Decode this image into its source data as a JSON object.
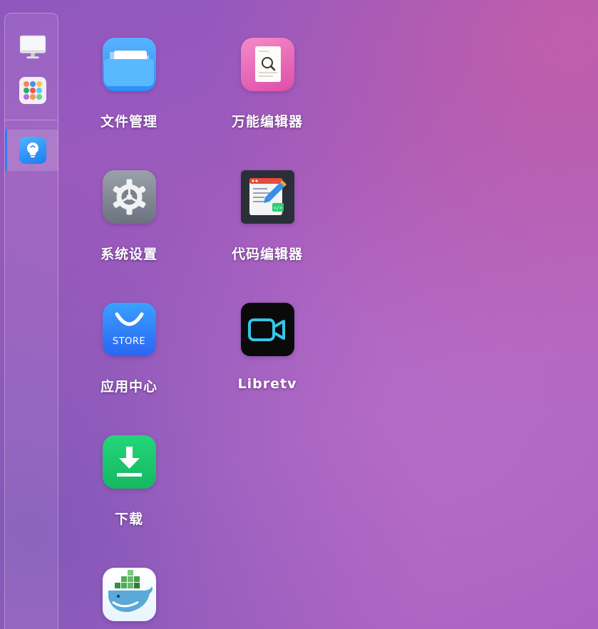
{
  "sidebar": {
    "items": [
      {
        "icon": "monitor-icon"
      },
      {
        "icon": "app-grid-icon"
      },
      {
        "icon": "lightbulb-icon",
        "active": true
      }
    ],
    "active_color": "#2f7cf6"
  },
  "apps": [
    {
      "label": "文件管理",
      "icon": "folder-icon"
    },
    {
      "label": "万能编辑器",
      "icon": "document-search-icon"
    },
    {
      "label": "系统设置",
      "icon": "gear-icon"
    },
    {
      "label": "代码编辑器",
      "icon": "code-editor-icon"
    },
    {
      "label": "应用中心",
      "icon": "store-bag-icon",
      "icon_text": "STORE"
    },
    {
      "label": "Libretv",
      "icon": "video-camera-icon"
    },
    {
      "label": "下载",
      "icon": "download-icon"
    },
    {
      "label": "",
      "icon": "docker-whale-icon"
    }
  ]
}
